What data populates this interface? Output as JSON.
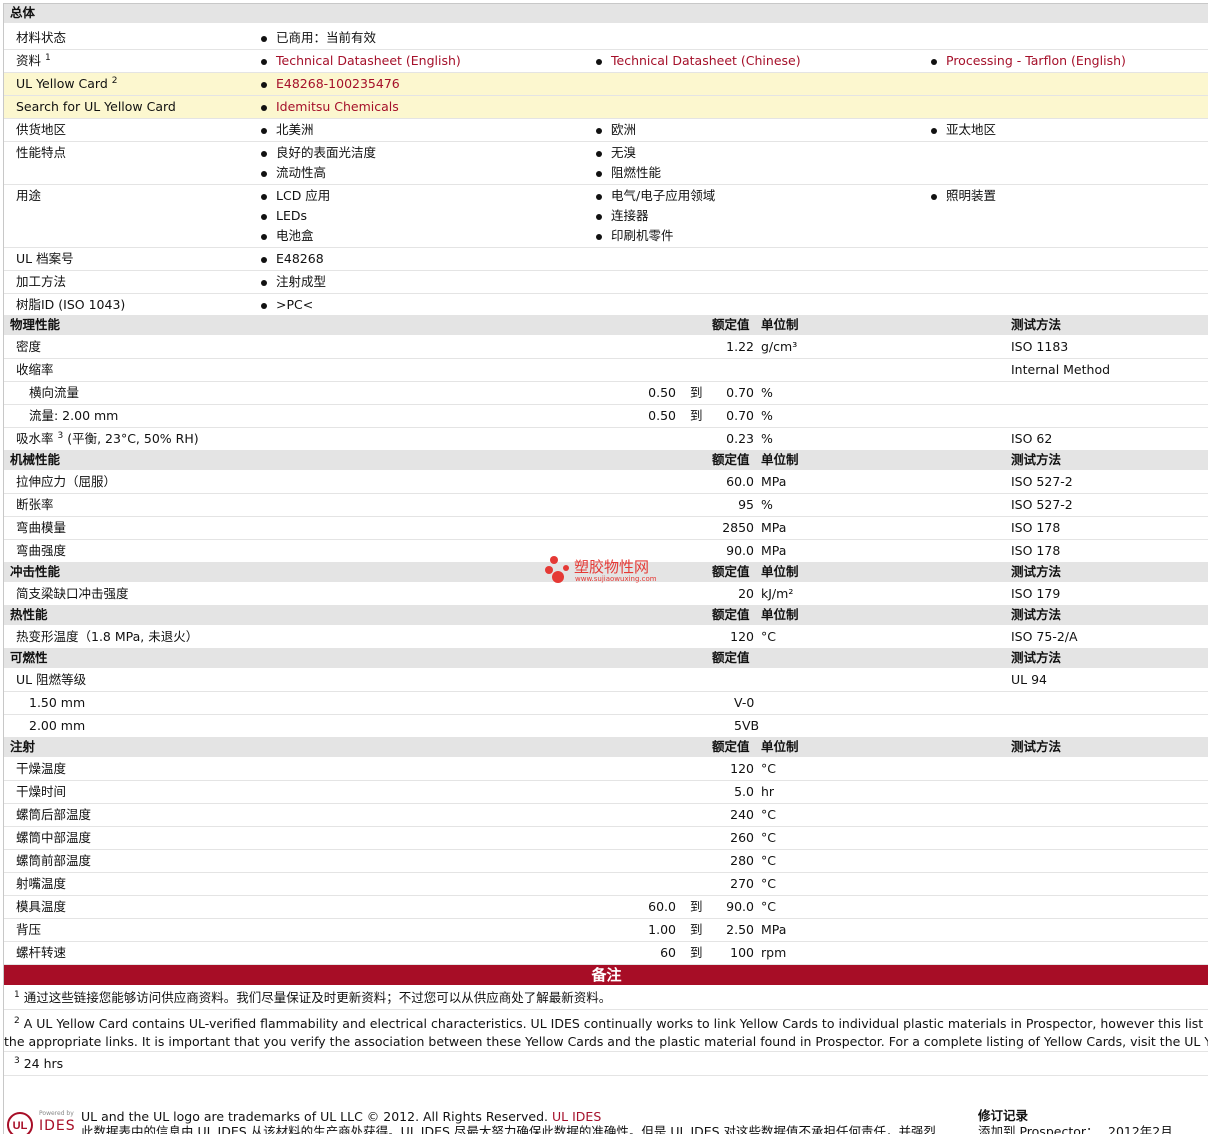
{
  "general": {
    "title": "总体",
    "material_status": {
      "label": "材料状态",
      "values": [
        "已商用：当前有效"
      ]
    },
    "docs": {
      "label": "资料",
      "sup": "1",
      "values": [
        "Technical Datasheet (English)",
        "Technical Datasheet (Chinese)",
        "Processing - Tarflon (English)"
      ]
    },
    "yellow_card": {
      "label": "UL Yellow Card",
      "sup": "2",
      "value": "E48268-100235476"
    },
    "search_yc": {
      "label": "Search for UL Yellow Card",
      "value": "Idemitsu Chemicals"
    },
    "availability": {
      "label": "供货地区",
      "values": [
        "北美洲",
        "欧洲",
        "亚太地区"
      ]
    },
    "features": {
      "label": "性能特点",
      "values": [
        "良好的表面光洁度",
        "无溴",
        "流动性高",
        "阻燃性能"
      ]
    },
    "uses": {
      "label": "用途",
      "values": [
        "LCD 应用",
        "电气/电子应用领域",
        "照明装置",
        "LEDs",
        "连接器",
        "电池盒",
        "印刷机零件"
      ]
    },
    "ul_file": {
      "label": "UL 档案号",
      "value": "E48268"
    },
    "processing": {
      "label": "加工方法",
      "value": "注射成型"
    },
    "resin_id": {
      "label": "树脂ID (ISO 1043)",
      "value": ">PC<"
    }
  },
  "hdr": {
    "nominal": "额定值",
    "unit": "单位制",
    "method": "测试方法"
  },
  "physical": {
    "title": "物理性能",
    "rows": [
      {
        "label": "密度",
        "v1": "",
        "to": "",
        "v2": "1.22",
        "unit": "g/cm³",
        "method": "ISO 1183"
      },
      {
        "label": "收缩率",
        "v1": "",
        "to": "",
        "v2": "",
        "unit": "",
        "method": "Internal Method"
      },
      {
        "label": "横向流量",
        "v1": "0.50",
        "to": "到",
        "v2": "0.70",
        "unit": "%",
        "method": ""
      },
      {
        "label": "流量: 2.00 mm",
        "v1": "0.50",
        "to": "到",
        "v2": "0.70",
        "unit": "%",
        "method": ""
      },
      {
        "label": "吸水率",
        "sup": "3",
        "label2": "(平衡, 23°C, 50% RH)",
        "v1": "",
        "to": "",
        "v2": "0.23",
        "unit": "%",
        "method": "ISO 62"
      }
    ]
  },
  "mechanical": {
    "title": "机械性能",
    "rows": [
      {
        "label": "拉伸应力（屈服）",
        "v2": "60.0",
        "unit": "MPa",
        "method": "ISO 527-2"
      },
      {
        "label": "断张率",
        "v2": "95",
        "unit": "%",
        "method": "ISO 527-2"
      },
      {
        "label": "弯曲模量",
        "v2": "2850",
        "unit": "MPa",
        "method": "ISO 178"
      },
      {
        "label": "弯曲强度",
        "v2": "90.0",
        "unit": "MPa",
        "method": "ISO 178"
      }
    ]
  },
  "impact": {
    "title": "冲击性能",
    "rows": [
      {
        "label": "简支梁缺口冲击强度",
        "v2": "20",
        "unit": "kJ/m²",
        "method": "ISO 179"
      }
    ]
  },
  "thermal": {
    "title": "热性能",
    "rows": [
      {
        "label": "热变形温度（1.8 MPa, 未退火）",
        "v2": "120",
        "unit": "°C",
        "method": "ISO 75-2/A"
      }
    ]
  },
  "flammability": {
    "title": "可燃性",
    "rows": [
      {
        "label": "UL 阻燃等级",
        "val": "",
        "method": "UL 94"
      },
      {
        "label": "1.50 mm",
        "val": "V-0",
        "method": ""
      },
      {
        "label": "2.00 mm",
        "val": "5VB",
        "method": ""
      }
    ]
  },
  "injection": {
    "title": "注射",
    "rows": [
      {
        "label": "干燥温度",
        "v1": "",
        "to": "",
        "v2": "120",
        "unit": "°C"
      },
      {
        "label": "干燥时间",
        "v1": "",
        "to": "",
        "v2": "5.0",
        "unit": "hr"
      },
      {
        "label": "螺筒后部温度",
        "v1": "",
        "to": "",
        "v2": "240",
        "unit": "°C"
      },
      {
        "label": "螺筒中部温度",
        "v1": "",
        "to": "",
        "v2": "260",
        "unit": "°C"
      },
      {
        "label": "螺筒前部温度",
        "v1": "",
        "to": "",
        "v2": "280",
        "unit": "°C"
      },
      {
        "label": "射嘴温度",
        "v1": "",
        "to": "",
        "v2": "270",
        "unit": "°C"
      },
      {
        "label": "模具温度",
        "v1": "60.0",
        "to": "到",
        "v2": "90.0",
        "unit": "°C"
      },
      {
        "label": "背压",
        "v1": "1.00",
        "to": "到",
        "v2": "2.50",
        "unit": "MPa"
      },
      {
        "label": "螺杆转速",
        "v1": "60",
        "to": "到",
        "v2": "100",
        "unit": "rpm"
      }
    ]
  },
  "notes": {
    "title": "备注",
    "n1": {
      "sup": "1",
      "text": "通过这些链接您能够访问供应商资料。我们尽量保证及时更新资料；不过您可以从供应商处了解最新资料。"
    },
    "n2": {
      "sup": "2",
      "text1": "A UL Yellow Card contains UL-verified flammability and electrical characteristics. UL IDES continually works to link Yellow Cards to individual plastic materials in Prospector, however this list may not includ",
      "text2": "the appropriate links. It is important that you verify the association between these Yellow Cards and the plastic material found in Prospector. For a complete listing of Yellow Cards, visit the UL Yellow Card Sear"
    },
    "n3": {
      "sup": "3",
      "text": "24 hrs"
    }
  },
  "footer": {
    "logo_small": "Powered by",
    "logo_text": "IDES",
    "line1": "UL and the UL logo are trademarks of UL LLC © 2012. All Rights Reserved.",
    "line1_link": "UL IDES",
    "line2": "此数据表中的信息由 UL IDES 从该材料的生产商处获得。UL IDES 尽最大努力确保此数据的准确性。但是 UL IDES 对这些数据值不承担任何责任，并强烈",
    "rev_title": "修订记录",
    "rev_line": "添加到 Prospector：",
    "rev_date": "2012年2月"
  },
  "watermark": {
    "main": "塑胶物性网",
    "sub": "www.sujiaowuxing.com"
  },
  "colors": {
    "link": "#a5102a",
    "band": "#a70d26",
    "yellow_row": "#fcf7cf",
    "section": "#e4e4e4"
  }
}
